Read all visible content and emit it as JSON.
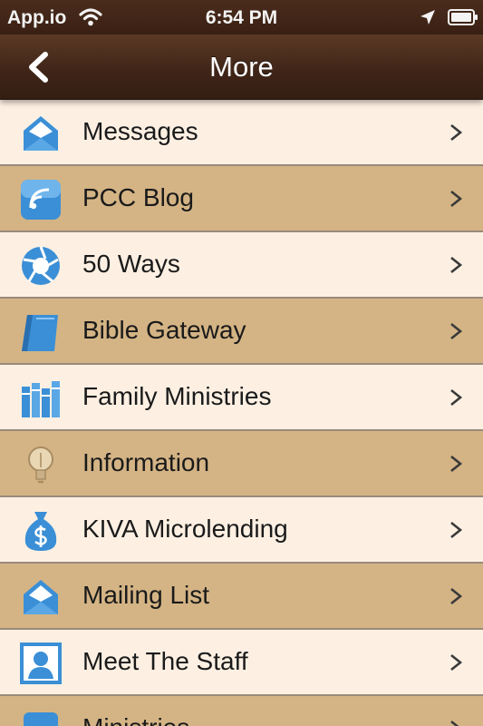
{
  "status_bar": {
    "carrier": "App.io",
    "time": "6:54 PM"
  },
  "nav": {
    "title": "More"
  },
  "menu": {
    "items": [
      {
        "label": "Messages",
        "icon": "envelope-icon"
      },
      {
        "label": "PCC Blog",
        "icon": "blog-rss-icon"
      },
      {
        "label": "50 Ways",
        "icon": "aperture-icon"
      },
      {
        "label": "Bible Gateway",
        "icon": "book-icon"
      },
      {
        "label": "Family Ministries",
        "icon": "books-icon"
      },
      {
        "label": "Information",
        "icon": "lightbulb-icon"
      },
      {
        "label": "KIVA Microlending",
        "icon": "money-bag-icon"
      },
      {
        "label": "Mailing List",
        "icon": "envelope-icon"
      },
      {
        "label": "Meet The Staff",
        "icon": "person-icon"
      },
      {
        "label": "Ministries",
        "icon": "ministries-icon"
      }
    ]
  },
  "colors": {
    "row_light": "#fdf0e3",
    "row_dark": "#d4b485",
    "nav_brown": "#3e2417",
    "icon_blue": "#3b8fd6"
  }
}
